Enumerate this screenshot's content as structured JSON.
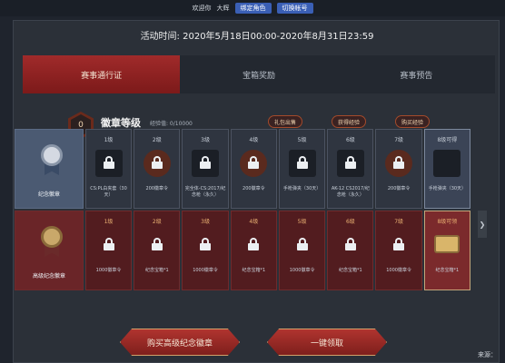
{
  "topbar": {
    "welcome": "欢迎你",
    "username": "大辉",
    "btn_reset": "绑定角色",
    "btn_switch": "切换帐号"
  },
  "activity": "活动时间: 2020年5月18日00:00-2020年8月31日23:59",
  "tabs": [
    "赛事通行证",
    "宝箱奖励",
    "赛事预告"
  ],
  "badge": {
    "level": "0",
    "title": "徽章等级",
    "exp": "经验值: 0/10000",
    "actions": [
      "礼包出售",
      "获得经验",
      "购买经验"
    ]
  },
  "free_row": {
    "first_label": "纪念徽章",
    "cells": [
      {
        "level": "1级",
        "desc": "CS:PL白夹套（30天）"
      },
      {
        "level": "2级",
        "desc": "200徽章令"
      },
      {
        "level": "3级",
        "desc": "完全体-CS:2017/纪念枪（永久）"
      },
      {
        "level": "4级",
        "desc": "200徽章令"
      },
      {
        "level": "5级",
        "desc": "手枪弹夹（30天）"
      },
      {
        "level": "6级",
        "desc": "AK-12 CS2017/纪念枪（永久）"
      },
      {
        "level": "7级",
        "desc": "200徽章令"
      },
      {
        "level": "8级可得",
        "desc": "手枪弹夹（30天）"
      }
    ]
  },
  "prem_row": {
    "first_label": "高级纪念徽章",
    "cells": [
      {
        "level": "1级",
        "desc": "1000徽章令"
      },
      {
        "level": "2级",
        "desc": "纪念宝箱*1"
      },
      {
        "level": "3级",
        "desc": "1000徽章令"
      },
      {
        "level": "4级",
        "desc": "纪念宝箱*1"
      },
      {
        "level": "5级",
        "desc": "1000徽章令"
      },
      {
        "level": "6级",
        "desc": "纪念宝箱*1"
      },
      {
        "level": "7级",
        "desc": "1000徽章令"
      },
      {
        "level": "8级可领",
        "desc": "纪念宝箱*1"
      }
    ]
  },
  "buttons": {
    "buy": "购买高级纪念徽章",
    "claim": "一键领取"
  },
  "source": "来源："
}
